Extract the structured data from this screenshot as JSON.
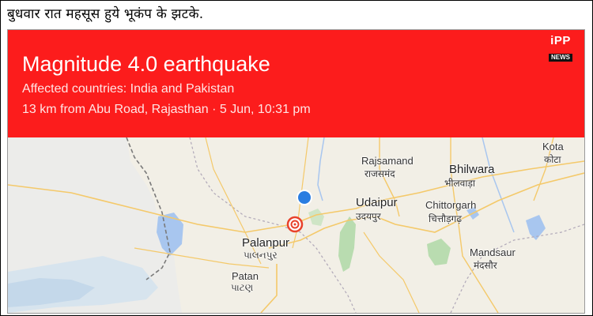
{
  "caption": "बुधवार रात महसूस हुये भूकंप के झटके.",
  "banner": {
    "headline": "Magnitude 4.0 earthquake",
    "affected": "Affected countries: India and Pakistan",
    "location": "13 km from Abu Road, Rajasthan · 5 Jun, 10:31 pm",
    "bg_color": "#fc1c1c"
  },
  "logo": {
    "top": "iPP",
    "bottom": "NEWS"
  },
  "map": {
    "places": [
      {
        "en": "Kota",
        "hi": "कोटा"
      },
      {
        "en": "Rajsamand",
        "hi": "राजसमंद"
      },
      {
        "en": "Bhilwara",
        "hi": "भीलवाड़ा"
      },
      {
        "en": "Udaipur",
        "hi": "उदयपुर"
      },
      {
        "en": "Chittorgarh",
        "hi": "चित्तौड़गढ़"
      },
      {
        "en": "Palanpur",
        "hi": "પાલનપુર"
      },
      {
        "en": "Mandsaur",
        "hi": "मंदसौर"
      },
      {
        "en": "Patan",
        "hi": "પાટણ"
      }
    ],
    "current_location_color": "#2a7de1",
    "epicenter_color": "#e8412b"
  }
}
